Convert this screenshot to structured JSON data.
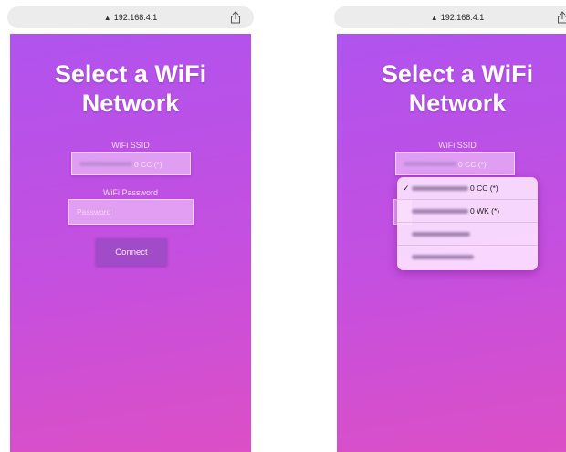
{
  "browser": {
    "url": "192.168.4.1",
    "lock_icon": "▲",
    "share_icon": "share-icon"
  },
  "page": {
    "title": "Select a WiFi Network",
    "ssid_label": "WiFi SSID",
    "ssid_value_suffix": "0 CC (*)",
    "password_label": "WiFi Password",
    "password_placeholder": "Password",
    "connect_label": "Connect"
  },
  "dropdown": {
    "options": [
      {
        "suffix": "0 CC (*)",
        "selected": true
      },
      {
        "suffix": "0 WK (*)",
        "selected": false
      },
      {
        "suffix": "",
        "selected": false
      },
      {
        "suffix": "",
        "selected": false
      }
    ],
    "check_mark": "✓"
  },
  "colors": {
    "gradient_top": "#b053ee",
    "gradient_bottom": "#dc4fc5",
    "button": "#a24bc9"
  }
}
